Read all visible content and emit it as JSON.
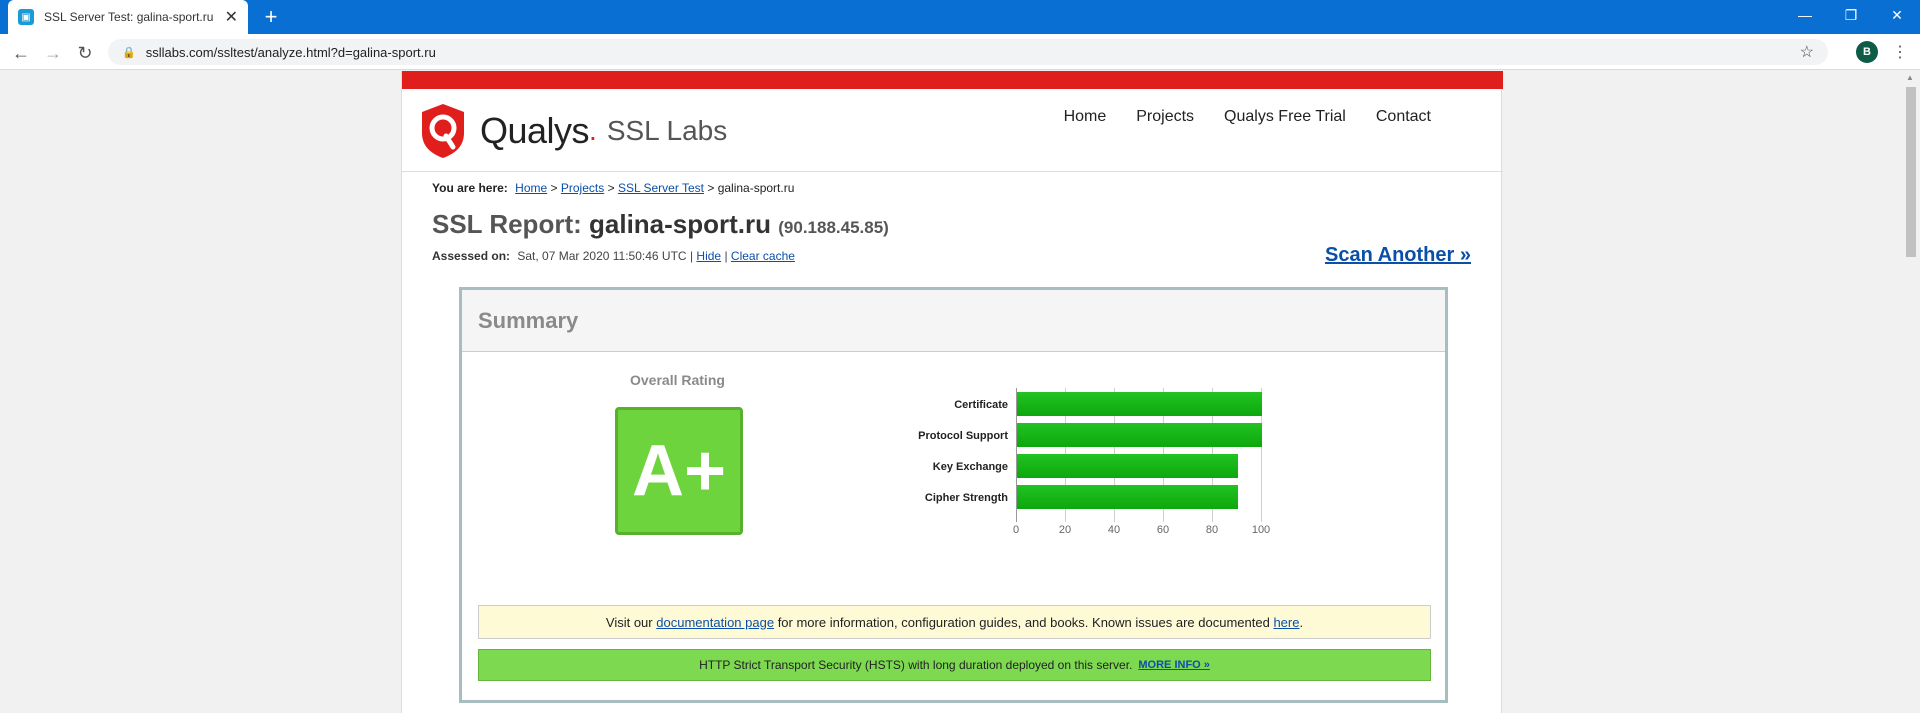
{
  "browser": {
    "tab_title": "SSL Server Test: galina-sport.ru (",
    "url": "ssllabs.com/ssltest/analyze.html?d=galina-sport.ru",
    "profile_initial": "B"
  },
  "header": {
    "brand": "Qualys",
    "brand_dot": ".",
    "product": "SSL Labs",
    "nav": [
      "Home",
      "Projects",
      "Qualys Free Trial",
      "Contact"
    ]
  },
  "breadcrumb": {
    "label": "You are here:",
    "items": [
      "Home",
      "Projects",
      "SSL Server Test"
    ],
    "sep": ">",
    "current": "galina-sport.ru"
  },
  "report": {
    "title_prefix": "SSL Report:",
    "host": "galina-sport.ru",
    "ip": "(90.188.45.85)",
    "assessed_label": "Assessed on:",
    "assessed_value": "Sat, 07 Mar 2020 11:50:46 UTC",
    "sep": "|",
    "hide_link": "Hide",
    "clear_cache_link": "Clear cache",
    "scan_another": "Scan Another »"
  },
  "summary": {
    "title": "Summary",
    "overall_label": "Overall Rating",
    "grade": "A+",
    "notice_yellow": {
      "pre": "Visit our",
      "link1": "documentation page",
      "mid": "for more information, configuration guides, and books. Known issues are documented",
      "link2": "here",
      "post": "."
    },
    "notice_green": {
      "text": "HTTP Strict Transport Security (HSTS) with long duration deployed on this server.",
      "link": "MORE INFO »"
    }
  },
  "chart_data": {
    "type": "bar",
    "orientation": "horizontal",
    "categories": [
      "Certificate",
      "Protocol Support",
      "Key Exchange",
      "Cipher Strength"
    ],
    "values": [
      100,
      100,
      90,
      90
    ],
    "xlim": [
      0,
      100
    ],
    "ticks": [
      0,
      20,
      40,
      60,
      80,
      100
    ],
    "grid": true,
    "bar_color": "#11b011"
  }
}
